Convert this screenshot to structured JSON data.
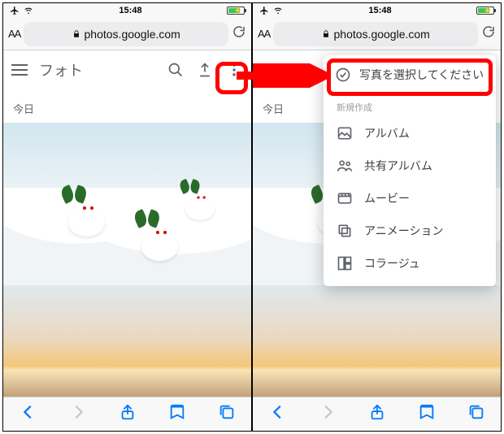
{
  "status": {
    "time": "15:48"
  },
  "browser": {
    "aa": "AA",
    "url": "photos.google.com"
  },
  "appbar": {
    "title": "フォト"
  },
  "section": {
    "today": "今日"
  },
  "dropdown": {
    "select_photos": "写真を選択してください",
    "section_label": "新規作成",
    "items": [
      {
        "label": "アルバム"
      },
      {
        "label": "共有アルバム"
      },
      {
        "label": "ムービー"
      },
      {
        "label": "アニメーション"
      },
      {
        "label": "コラージュ"
      }
    ]
  }
}
